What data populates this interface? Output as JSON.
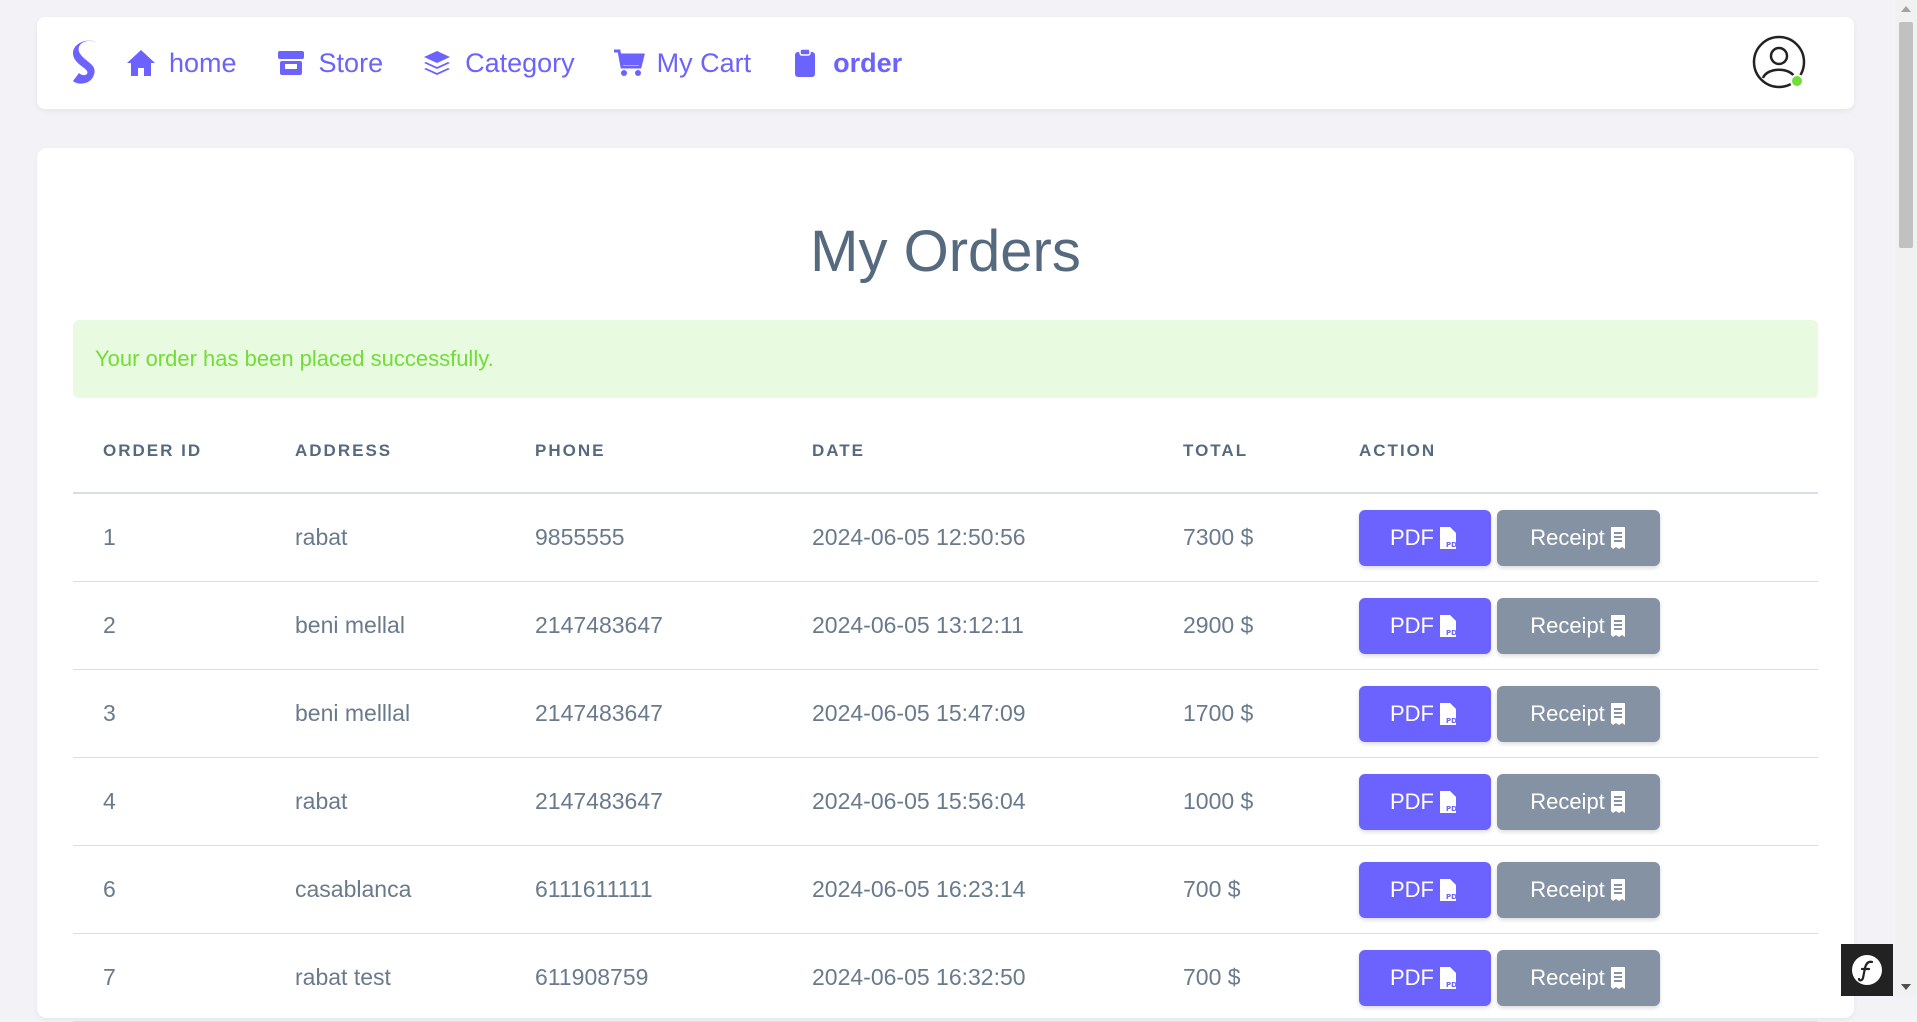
{
  "nav": {
    "items": [
      {
        "label": "home",
        "icon": "home-icon"
      },
      {
        "label": "Store",
        "icon": "store-icon"
      },
      {
        "label": "Category",
        "icon": "layers-icon"
      },
      {
        "label": "My Cart",
        "icon": "cart-icon"
      },
      {
        "label": "order",
        "icon": "clipboard-icon",
        "active": true
      }
    ]
  },
  "page": {
    "title": "My Orders",
    "alert": "Your order has been placed successfully."
  },
  "table": {
    "headers": [
      "ORDER ID",
      "ADDRESS",
      "PHONE",
      "DATE",
      "TOTAL",
      "ACTION"
    ],
    "rows": [
      {
        "id": "1",
        "address": "rabat",
        "phone": "9855555",
        "date": "2024-06-05 12:50:56",
        "total": "7300 $"
      },
      {
        "id": "2",
        "address": "beni mellal",
        "phone": "2147483647",
        "date": "2024-06-05 13:12:11",
        "total": "2900 $"
      },
      {
        "id": "3",
        "address": "beni melllal",
        "phone": "2147483647",
        "date": "2024-06-05 15:47:09",
        "total": "1700 $"
      },
      {
        "id": "4",
        "address": "rabat",
        "phone": "2147483647",
        "date": "2024-06-05 15:56:04",
        "total": "1000 $"
      },
      {
        "id": "6",
        "address": "casablanca",
        "phone": "6111611111",
        "date": "2024-06-05 16:23:14",
        "total": "700 $"
      },
      {
        "id": "7",
        "address": "rabat test",
        "phone": "611908759",
        "date": "2024-06-05 16:32:50",
        "total": "700 $"
      }
    ],
    "actions": {
      "pdf_label": "PDF",
      "receipt_label": "Receipt"
    }
  },
  "colors": {
    "accent": "#6c63ff",
    "secondary": "#8592a3",
    "success_bg": "#e8fadf",
    "success_text": "#71dd37",
    "text": "#566a7f",
    "online": "#71dd37"
  }
}
